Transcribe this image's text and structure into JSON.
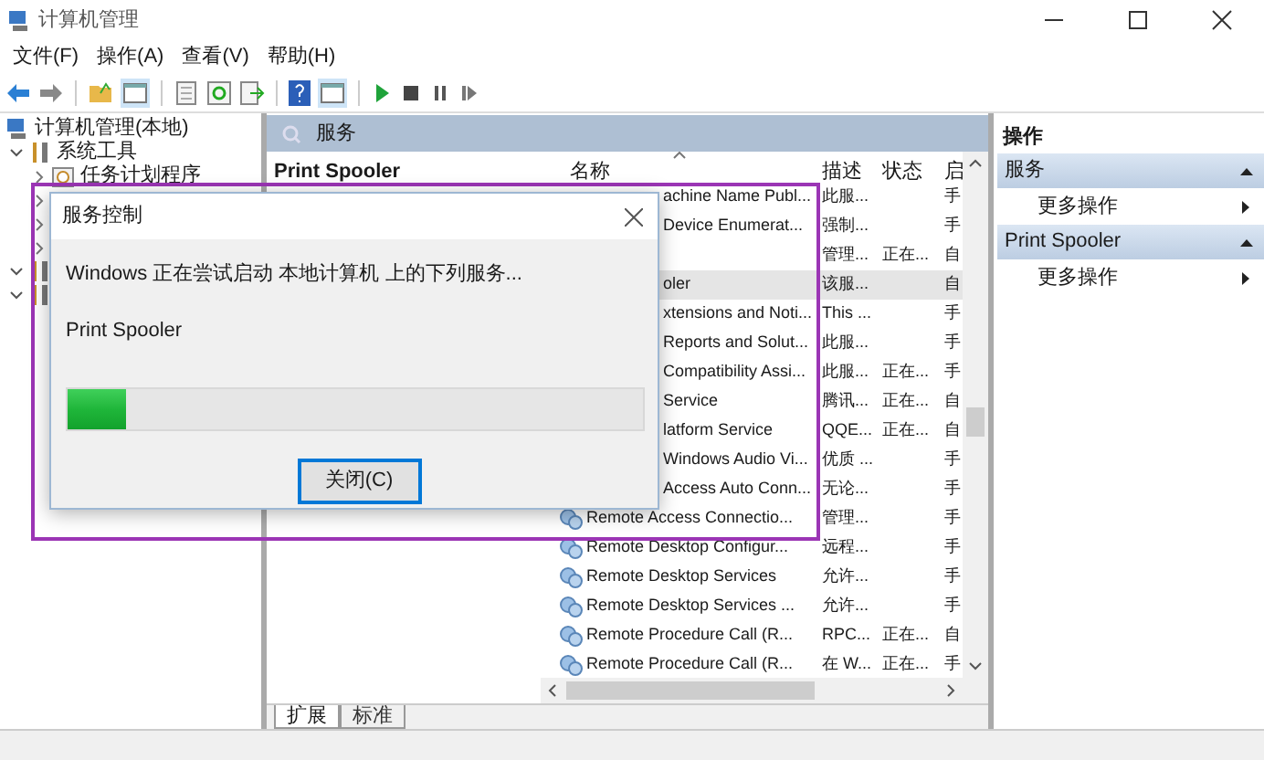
{
  "window": {
    "title": "计算机管理"
  },
  "menu": [
    "文件(F)",
    "操作(A)",
    "查看(V)",
    "帮助(H)"
  ],
  "tree": [
    {
      "label": "计算机管理(本地)",
      "children": [
        {
          "label": "系统工具",
          "expanded": true,
          "children": [
            {
              "label": "任务计划程序",
              "expanded": false
            },
            {
              "expanded": false
            },
            {
              "expanded": false
            },
            {
              "expanded": false
            }
          ]
        },
        {
          "expanded": true
        },
        {
          "expanded": true
        }
      ]
    }
  ],
  "services_panel": {
    "title": "服务",
    "selected_service": "Print Spooler",
    "columns": [
      "名称",
      "描述",
      "状态",
      "启"
    ],
    "rows": [
      {
        "name": "achine Name Publ...",
        "description": "此服...",
        "startup": "手",
        "icon": false,
        "selected": false
      },
      {
        "name": "Device Enumerat...",
        "description": "强制...",
        "startup": "手",
        "icon": false,
        "selected": false
      },
      {
        "description": "管理...",
        "status": "正在...",
        "startup": "自",
        "icon": false,
        "selected": false
      },
      {
        "name": "oler",
        "description": "该服...",
        "startup": "自",
        "icon": false,
        "selected": true
      },
      {
        "name": "xtensions and Noti...",
        "description": "This ...",
        "startup": "手",
        "icon": false,
        "selected": false
      },
      {
        "name": "Reports and Solut...",
        "description": "此服...",
        "startup": "手",
        "icon": false,
        "selected": false
      },
      {
        "name": "Compatibility Assi...",
        "description": "此服...",
        "status": "正在...",
        "startup": "手",
        "icon": false,
        "selected": false
      },
      {
        "name": "Service",
        "description": "腾讯...",
        "status": "正在...",
        "startup": "自",
        "icon": false,
        "selected": false
      },
      {
        "name": "latform Service",
        "description": "QQE...",
        "status": "正在...",
        "startup": "自",
        "icon": false,
        "selected": false
      },
      {
        "name": "Windows Audio Vi...",
        "description": "优质 ...",
        "startup": "手",
        "icon": false,
        "selected": false
      },
      {
        "name": "Access Auto Conn...",
        "description": "无论...",
        "startup": "手",
        "icon": false,
        "selected": false
      },
      {
        "name": "Remote Access Connectio...",
        "description": "管理...",
        "startup": "手",
        "icon": true,
        "selected": false
      },
      {
        "name": "Remote Desktop Configur...",
        "description": "远程...",
        "startup": "手",
        "icon": true,
        "selected": false
      },
      {
        "name": "Remote Desktop Services",
        "description": "允许...",
        "startup": "手",
        "icon": true,
        "selected": false
      },
      {
        "name": "Remote Desktop Services ...",
        "description": "允许...",
        "startup": "手",
        "icon": true,
        "selected": false
      },
      {
        "name": "Remote Procedure Call (R...",
        "description": "RPC...",
        "status": "正在...",
        "startup": "自",
        "icon": true,
        "selected": false
      },
      {
        "name": "Remote Procedure Call (R...",
        "description": "在 W...",
        "status": "正在...",
        "startup": "手",
        "icon": true,
        "selected": false
      }
    ],
    "tabs": [
      {
        "label": "扩展",
        "selected": true
      },
      {
        "label": "标准",
        "selected": false
      }
    ]
  },
  "actions": {
    "title": "操作",
    "sections": [
      {
        "title": "服务",
        "items": [
          "更多操作"
        ]
      },
      {
        "title": "Print Spooler",
        "items": [
          "更多操作"
        ]
      }
    ]
  },
  "dialog": {
    "title": "服务控制",
    "message": "Windows 正在尝试启动 本地计算机 上的下列服务...",
    "service": "Print Spooler",
    "progress": {
      "level": 0.1
    },
    "button": "关闭(C)"
  }
}
